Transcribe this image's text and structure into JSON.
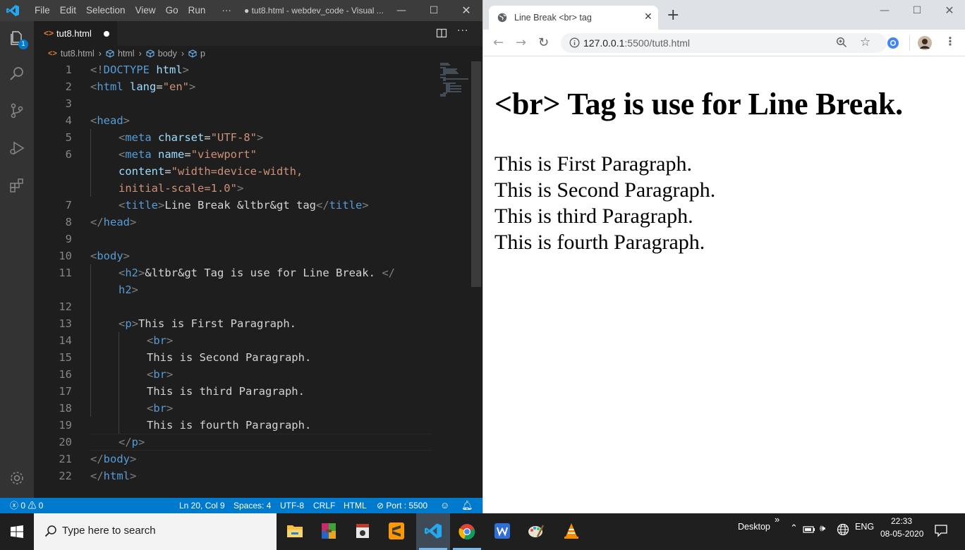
{
  "vscode": {
    "menu": [
      "File",
      "Edit",
      "Selection",
      "View",
      "Go",
      "Run",
      "···"
    ],
    "window_title": "● tut8.html - webdev_code - Visual ...",
    "explorer_badge": "1",
    "tab": {
      "name": "tut8.html",
      "unsaved": true
    },
    "breadcrumb": [
      "tut8.html",
      "html",
      "body",
      "p"
    ],
    "lines": [
      {
        "n": "1",
        "tokens": [
          [
            "br",
            "<!"
          ],
          [
            "tag",
            "DOCTYPE"
          ],
          [
            "txt",
            " "
          ],
          [
            "attr",
            "html"
          ],
          [
            "br",
            ">"
          ]
        ]
      },
      {
        "n": "2",
        "tokens": [
          [
            "br",
            "<"
          ],
          [
            "tag",
            "html"
          ],
          [
            "txt",
            " "
          ],
          [
            "attr",
            "lang"
          ],
          [
            "txt",
            "="
          ],
          [
            "str",
            "\"en\""
          ],
          [
            "br",
            ">"
          ]
        ]
      },
      {
        "n": "3",
        "tokens": []
      },
      {
        "n": "4",
        "tokens": [
          [
            "br",
            "<"
          ],
          [
            "tag",
            "head"
          ],
          [
            "br",
            ">"
          ]
        ]
      },
      {
        "n": "5",
        "indent": 1,
        "tokens": [
          [
            "br",
            "<"
          ],
          [
            "tag",
            "meta"
          ],
          [
            "txt",
            " "
          ],
          [
            "attr",
            "charset"
          ],
          [
            "txt",
            "="
          ],
          [
            "str",
            "\"UTF-8\""
          ],
          [
            "br",
            ">"
          ]
        ]
      },
      {
        "n": "6",
        "indent": 1,
        "tokens": [
          [
            "br",
            "<"
          ],
          [
            "tag",
            "meta"
          ],
          [
            "txt",
            " "
          ],
          [
            "attr",
            "name"
          ],
          [
            "txt",
            "="
          ],
          [
            "str",
            "\"viewport\""
          ]
        ]
      },
      {
        "n": "",
        "indent": 1,
        "tokens": [
          [
            "attr",
            "content"
          ],
          [
            "txt",
            "="
          ],
          [
            "str",
            "\"width=device-width,"
          ]
        ]
      },
      {
        "n": "",
        "indent": 1,
        "tokens": [
          [
            "str",
            "initial-scale=1.0\""
          ],
          [
            "br",
            ">"
          ]
        ]
      },
      {
        "n": "7",
        "indent": 1,
        "tokens": [
          [
            "br",
            "<"
          ],
          [
            "tag",
            "title"
          ],
          [
            "br",
            ">"
          ],
          [
            "txt",
            "Line Break &ltbr&gt tag"
          ],
          [
            "br",
            "</"
          ],
          [
            "tag",
            "title"
          ],
          [
            "br",
            ">"
          ]
        ]
      },
      {
        "n": "8",
        "tokens": [
          [
            "br",
            "</"
          ],
          [
            "tag",
            "head"
          ],
          [
            "br",
            ">"
          ]
        ]
      },
      {
        "n": "9",
        "tokens": []
      },
      {
        "n": "10",
        "tokens": [
          [
            "br",
            "<"
          ],
          [
            "tag",
            "body"
          ],
          [
            "br",
            ">"
          ]
        ]
      },
      {
        "n": "11",
        "indent": 1,
        "tokens": [
          [
            "br",
            "<"
          ],
          [
            "tag",
            "h2"
          ],
          [
            "br",
            ">"
          ],
          [
            "txt",
            "&ltbr&gt Tag is use for Line Break. "
          ],
          [
            "br",
            "</"
          ]
        ]
      },
      {
        "n": "",
        "indent": 1,
        "tokens": [
          [
            "tag",
            "h2"
          ],
          [
            "br",
            ">"
          ]
        ]
      },
      {
        "n": "12",
        "tokens": []
      },
      {
        "n": "13",
        "indent": 1,
        "tokens": [
          [
            "br",
            "<"
          ],
          [
            "tag",
            "p"
          ],
          [
            "br",
            ">"
          ],
          [
            "txt",
            "This is First Paragraph."
          ]
        ]
      },
      {
        "n": "14",
        "indent": 2,
        "tokens": [
          [
            "br",
            "<"
          ],
          [
            "tag",
            "br"
          ],
          [
            "br",
            ">"
          ]
        ]
      },
      {
        "n": "15",
        "indent": 2,
        "tokens": [
          [
            "txt",
            "This is Second Paragraph."
          ]
        ]
      },
      {
        "n": "16",
        "indent": 2,
        "tokens": [
          [
            "br",
            "<"
          ],
          [
            "tag",
            "br"
          ],
          [
            "br",
            ">"
          ]
        ]
      },
      {
        "n": "17",
        "indent": 2,
        "tokens": [
          [
            "txt",
            "This is third Paragraph."
          ]
        ]
      },
      {
        "n": "18",
        "indent": 2,
        "tokens": [
          [
            "br",
            "<"
          ],
          [
            "tag",
            "br"
          ],
          [
            "br",
            ">"
          ]
        ]
      },
      {
        "n": "19",
        "indent": 2,
        "tokens": [
          [
            "txt",
            "This is fourth Paragraph."
          ]
        ]
      },
      {
        "n": "20",
        "indent": 1,
        "tokens": [
          [
            "br",
            "</"
          ],
          [
            "tag",
            "p"
          ],
          [
            "br",
            ">"
          ]
        ]
      },
      {
        "n": "21",
        "tokens": [
          [
            "br",
            "</"
          ],
          [
            "tag",
            "body"
          ],
          [
            "br",
            ">"
          ]
        ]
      },
      {
        "n": "22",
        "tokens": [
          [
            "br",
            "</"
          ],
          [
            "tag",
            "html"
          ],
          [
            "br",
            ">"
          ]
        ]
      }
    ],
    "status": {
      "problems": "ⓧ 0 ⚠ 0",
      "position": "Ln 20, Col 9",
      "spaces": "Spaces: 4",
      "encoding": "UTF-8",
      "eol": "CRLF",
      "language": "HTML",
      "port": "⊘ Port : 5500"
    },
    "colors": {
      "accent": "#007acc",
      "tag": "#569cd6",
      "attr": "#9cdcfe",
      "string": "#ce9178"
    }
  },
  "chrome": {
    "tab_title": "Line Break <br> tag",
    "url_host": "127.0.0.1",
    "url_path": ":5500/tut8.html",
    "heading": "<br> Tag is use for Line Break.",
    "paragraphs": [
      "This is First Paragraph.",
      "This is Second Paragraph.",
      "This is third Paragraph.",
      "This is fourth Paragraph."
    ]
  },
  "taskbar": {
    "search_placeholder": "Type here to search",
    "desktop_label": "Desktop",
    "language": "ENG",
    "time": "22:33",
    "date": "08-05-2020",
    "apps": [
      "file-explorer-icon",
      "winrar-icon",
      "media-icon",
      "sublime-text-icon",
      "vscode-icon",
      "chrome-icon",
      "writer-icon",
      "paint-icon",
      "vlc-icon"
    ]
  }
}
